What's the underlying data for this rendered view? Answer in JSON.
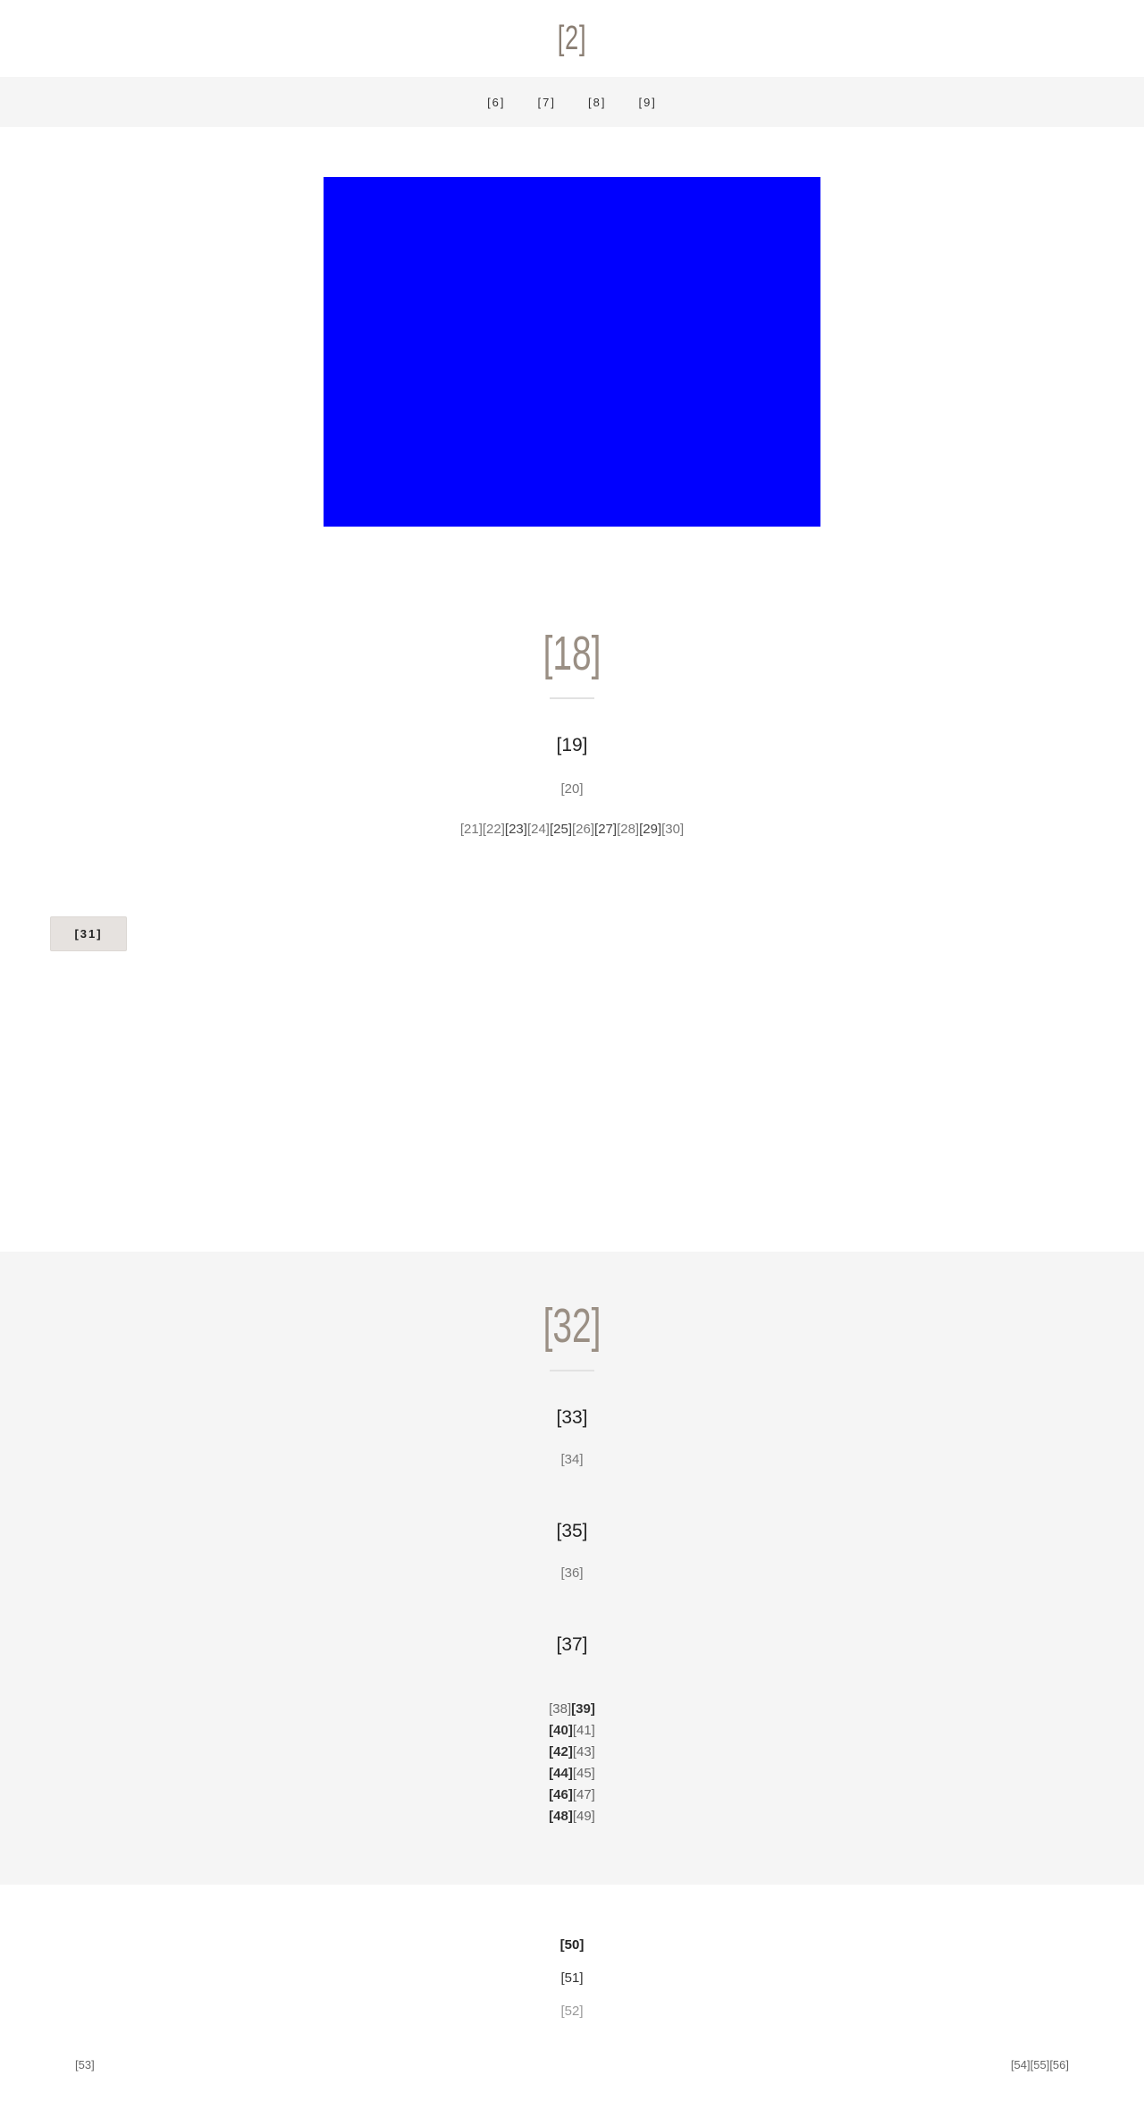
{
  "header": {
    "site_title": "[2]",
    "nav": [
      "[6]",
      "[7]",
      "[8]",
      "[9]"
    ]
  },
  "hero": {
    "image_color": "#0000ff"
  },
  "about": {
    "title": "[18]",
    "subhead": "[19]",
    "meta": "[20]",
    "tags": [
      {
        "text": "[21]",
        "strong": false
      },
      {
        "text": "[22]",
        "strong": false
      },
      {
        "text": "[23]",
        "strong": true
      },
      {
        "text": "[24]",
        "strong": false
      },
      {
        "text": "[25]",
        "strong": true
      },
      {
        "text": "[26]",
        "strong": false
      },
      {
        "text": "[27]",
        "strong": true
      },
      {
        "text": "[28]",
        "strong": false
      },
      {
        "text": "[29]",
        "strong": true
      },
      {
        "text": "[30]",
        "strong": false
      }
    ],
    "button_label": "[31]"
  },
  "contact": {
    "title": "[32]",
    "block1_heading": "[33]",
    "block1_text": "[34]",
    "block2_heading": "[35]",
    "block2_text": "[36]",
    "block3_heading": "[37]",
    "hours": [
      {
        "day": "[38]",
        "time": "[39]",
        "bold_first": false
      },
      {
        "day": "[40]",
        "time": "[41]",
        "bold_first": true
      },
      {
        "day": "[42]",
        "time": "[43]",
        "bold_first": true
      },
      {
        "day": "[44]",
        "time": "[45]",
        "bold_first": true
      },
      {
        "day": "[46]",
        "time": "[47]",
        "bold_first": true
      },
      {
        "day": "[48]",
        "time": "[49]",
        "bold_first": true
      }
    ]
  },
  "footer": {
    "line1": "[50]",
    "line2": "[51]",
    "line3": "[52]",
    "left_small": "[53]",
    "right_links": [
      "[54]",
      "[55]",
      "[56]"
    ]
  },
  "colors": {
    "accent_title": "#9a8f84",
    "nav_bg": "#f5f5f5",
    "button_bg": "#e6e2df"
  }
}
